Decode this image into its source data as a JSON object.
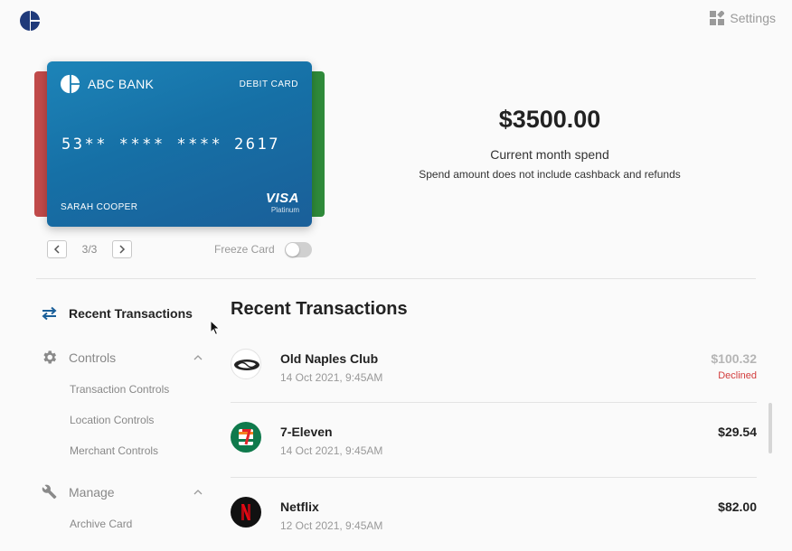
{
  "header": {
    "settings_label": "Settings",
    "settings_icon": "grid-icon",
    "logo_color": "#1f3a7a"
  },
  "card": {
    "bank_name": "ABC BANK",
    "card_type": "DEBIT CARD",
    "number": "53** **** **** 2617",
    "holder": "SARAH COOPER",
    "network": "VISA",
    "tier": "Platinum",
    "pager": "3/3",
    "freeze_label": "Freeze Card",
    "freeze_on": false,
    "colors": {
      "card": "#1670a6",
      "back_left": "#c04a4a",
      "back_right": "#2f8a3a"
    }
  },
  "spend": {
    "amount": "$3500.00",
    "label": "Current month spend",
    "note": "Spend amount does not include cashback and refunds"
  },
  "sidebar": {
    "items": [
      {
        "label": "Recent Transactions",
        "icon": "swap-arrows-icon",
        "active": true
      },
      {
        "label": "Controls",
        "icon": "gear-icon",
        "expanded": true,
        "subitems": [
          "Transaction Controls",
          "Location Controls",
          "Merchant Controls"
        ]
      },
      {
        "label": "Manage",
        "icon": "wrench-icon",
        "expanded": true,
        "subitems": [
          "Archive Card"
        ]
      }
    ]
  },
  "transactions": {
    "title": "Recent Transactions",
    "items": [
      {
        "merchant": "Old Naples Club",
        "date": "14 Oct 2021, 9:45AM",
        "amount": "$100.32",
        "status": "Declined",
        "icon": "old-naples-club-logo-icon"
      },
      {
        "merchant": "7-Eleven",
        "date": "14 Oct 2021, 9:45AM",
        "amount": "$29.54",
        "status": "",
        "icon": "7-eleven-logo-icon"
      },
      {
        "merchant": "Netflix",
        "date": "12 Oct 2021, 9:45AM",
        "amount": "$82.00",
        "status": "",
        "icon": "netflix-logo-icon"
      }
    ]
  },
  "colors": {
    "accent": "#1a5f99",
    "declined": "#d23c3c",
    "muted": "#888888"
  }
}
